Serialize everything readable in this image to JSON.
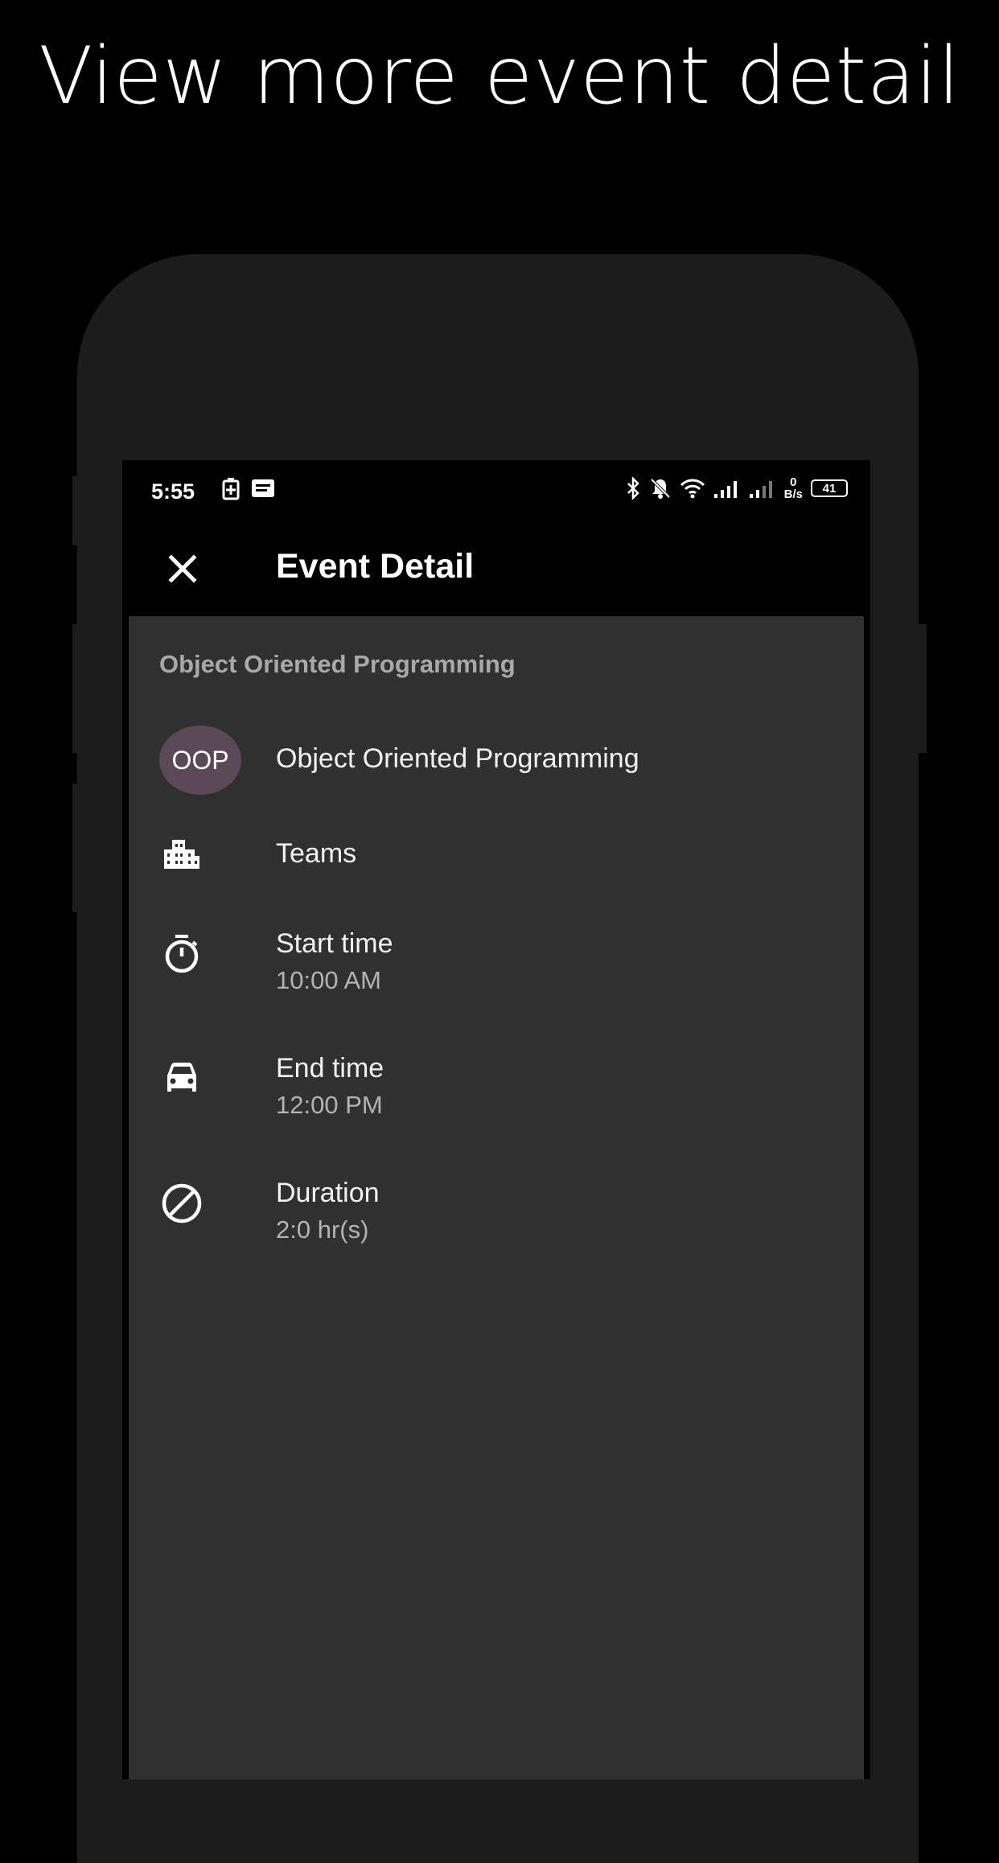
{
  "promo": {
    "title": "View more event detail"
  },
  "status_bar": {
    "time": "5:55",
    "speed_value": "0",
    "speed_unit": "B/s",
    "battery": "41"
  },
  "app_bar": {
    "title": "Event Detail",
    "close_icon": "close-icon"
  },
  "event": {
    "section_header": "Object Oriented Programming",
    "avatar_text": "OOP",
    "course_name": "Object Oriented Programming",
    "location": "Teams",
    "start_label": "Start time",
    "start_value": "10:00 AM",
    "end_label": "End time",
    "end_value": "12:00 PM",
    "duration_label": "Duration",
    "duration_value": "2:0 hr(s)"
  },
  "colors": {
    "background": "#000000",
    "phone_frame": "#1c1c1c",
    "content_bg": "#303030",
    "avatar_bg": "#5a4a58",
    "secondary_text": "#b3b3b3"
  }
}
